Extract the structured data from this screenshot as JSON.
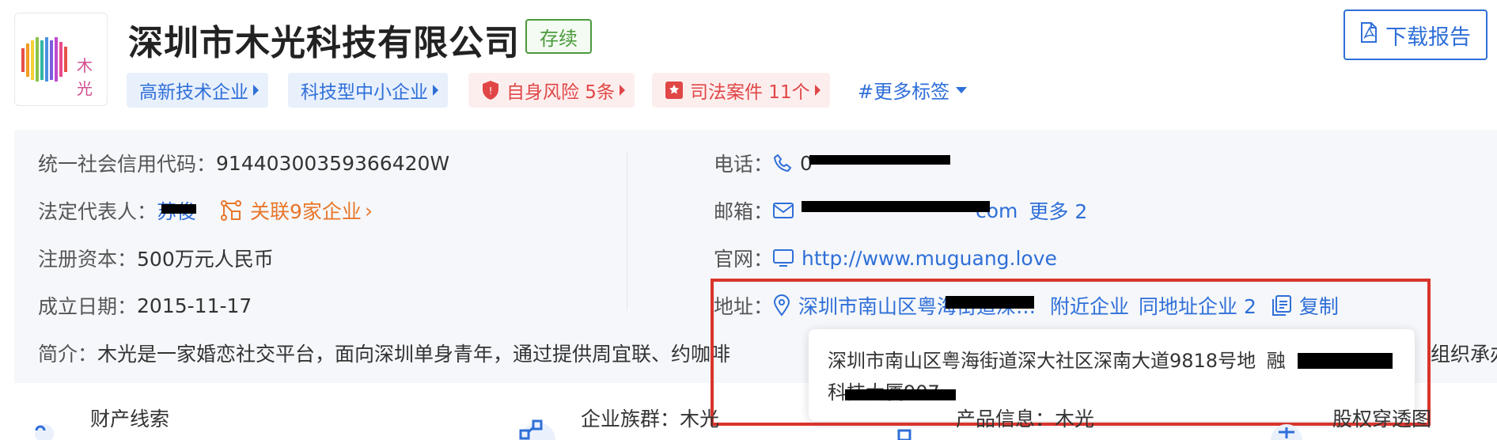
{
  "company": {
    "logo_text": "木光",
    "name": "深圳市木光科技有限公司",
    "status": "存续",
    "download_label": "下载报告"
  },
  "tags": [
    {
      "label": "高新技术企业",
      "color": "#2f6fd8"
    },
    {
      "label": "科技型中小企业",
      "color": "#2f6fd8"
    },
    {
      "label": "自身风险 5条",
      "color": "#e04646"
    },
    {
      "label": "司法案件 11个",
      "color": "#e04646"
    }
  ],
  "more_tags": "#更多标签",
  "info": {
    "credit_code_label": "统一社会信用代码：",
    "credit_code": "91440300359366420W",
    "legal_rep_label": "法定代表人：",
    "legal_rep": "苏俊",
    "related_companies": "关联9家企业",
    "capital_label": "注册资本：",
    "capital": "500万元人民币",
    "founded_label": "成立日期：",
    "founded": "2015-11-17",
    "intro_label": "简介：",
    "intro": "木光是一家婚恋社交平台，面向深圳单身青年，通过提供周宜联、约咖啡",
    "intro_tail": "组织承办",
    "phone_label": "电话：",
    "phone": "0",
    "email_label": "邮箱：",
    "email_tail": "com",
    "email_more": "更多 2",
    "website_label": "官网：",
    "website": "http://www.muguang.love",
    "address_label": "地址：",
    "address": "深圳市南山区粤海街道深…",
    "nearby": "附近企业",
    "same_address": "同地址企业 2",
    "copy": "复制"
  },
  "tooltip": {
    "line1": "深圳市南山区粤海街道深大社区深南大道9818号地",
    "line1_tail": "融",
    "line2": "科技大厦907"
  },
  "bottom": [
    {
      "label": "财产线索"
    },
    {
      "label": "企业族群：木光"
    },
    {
      "label": "产品信息：木光"
    },
    {
      "label": "股权穿透图"
    }
  ],
  "colors": {
    "accent": "#2f6fd8",
    "status_green": "#4a9a3c",
    "risk_red": "#e04646",
    "orange": "#e8772a",
    "highlight_red": "#d9342b"
  }
}
